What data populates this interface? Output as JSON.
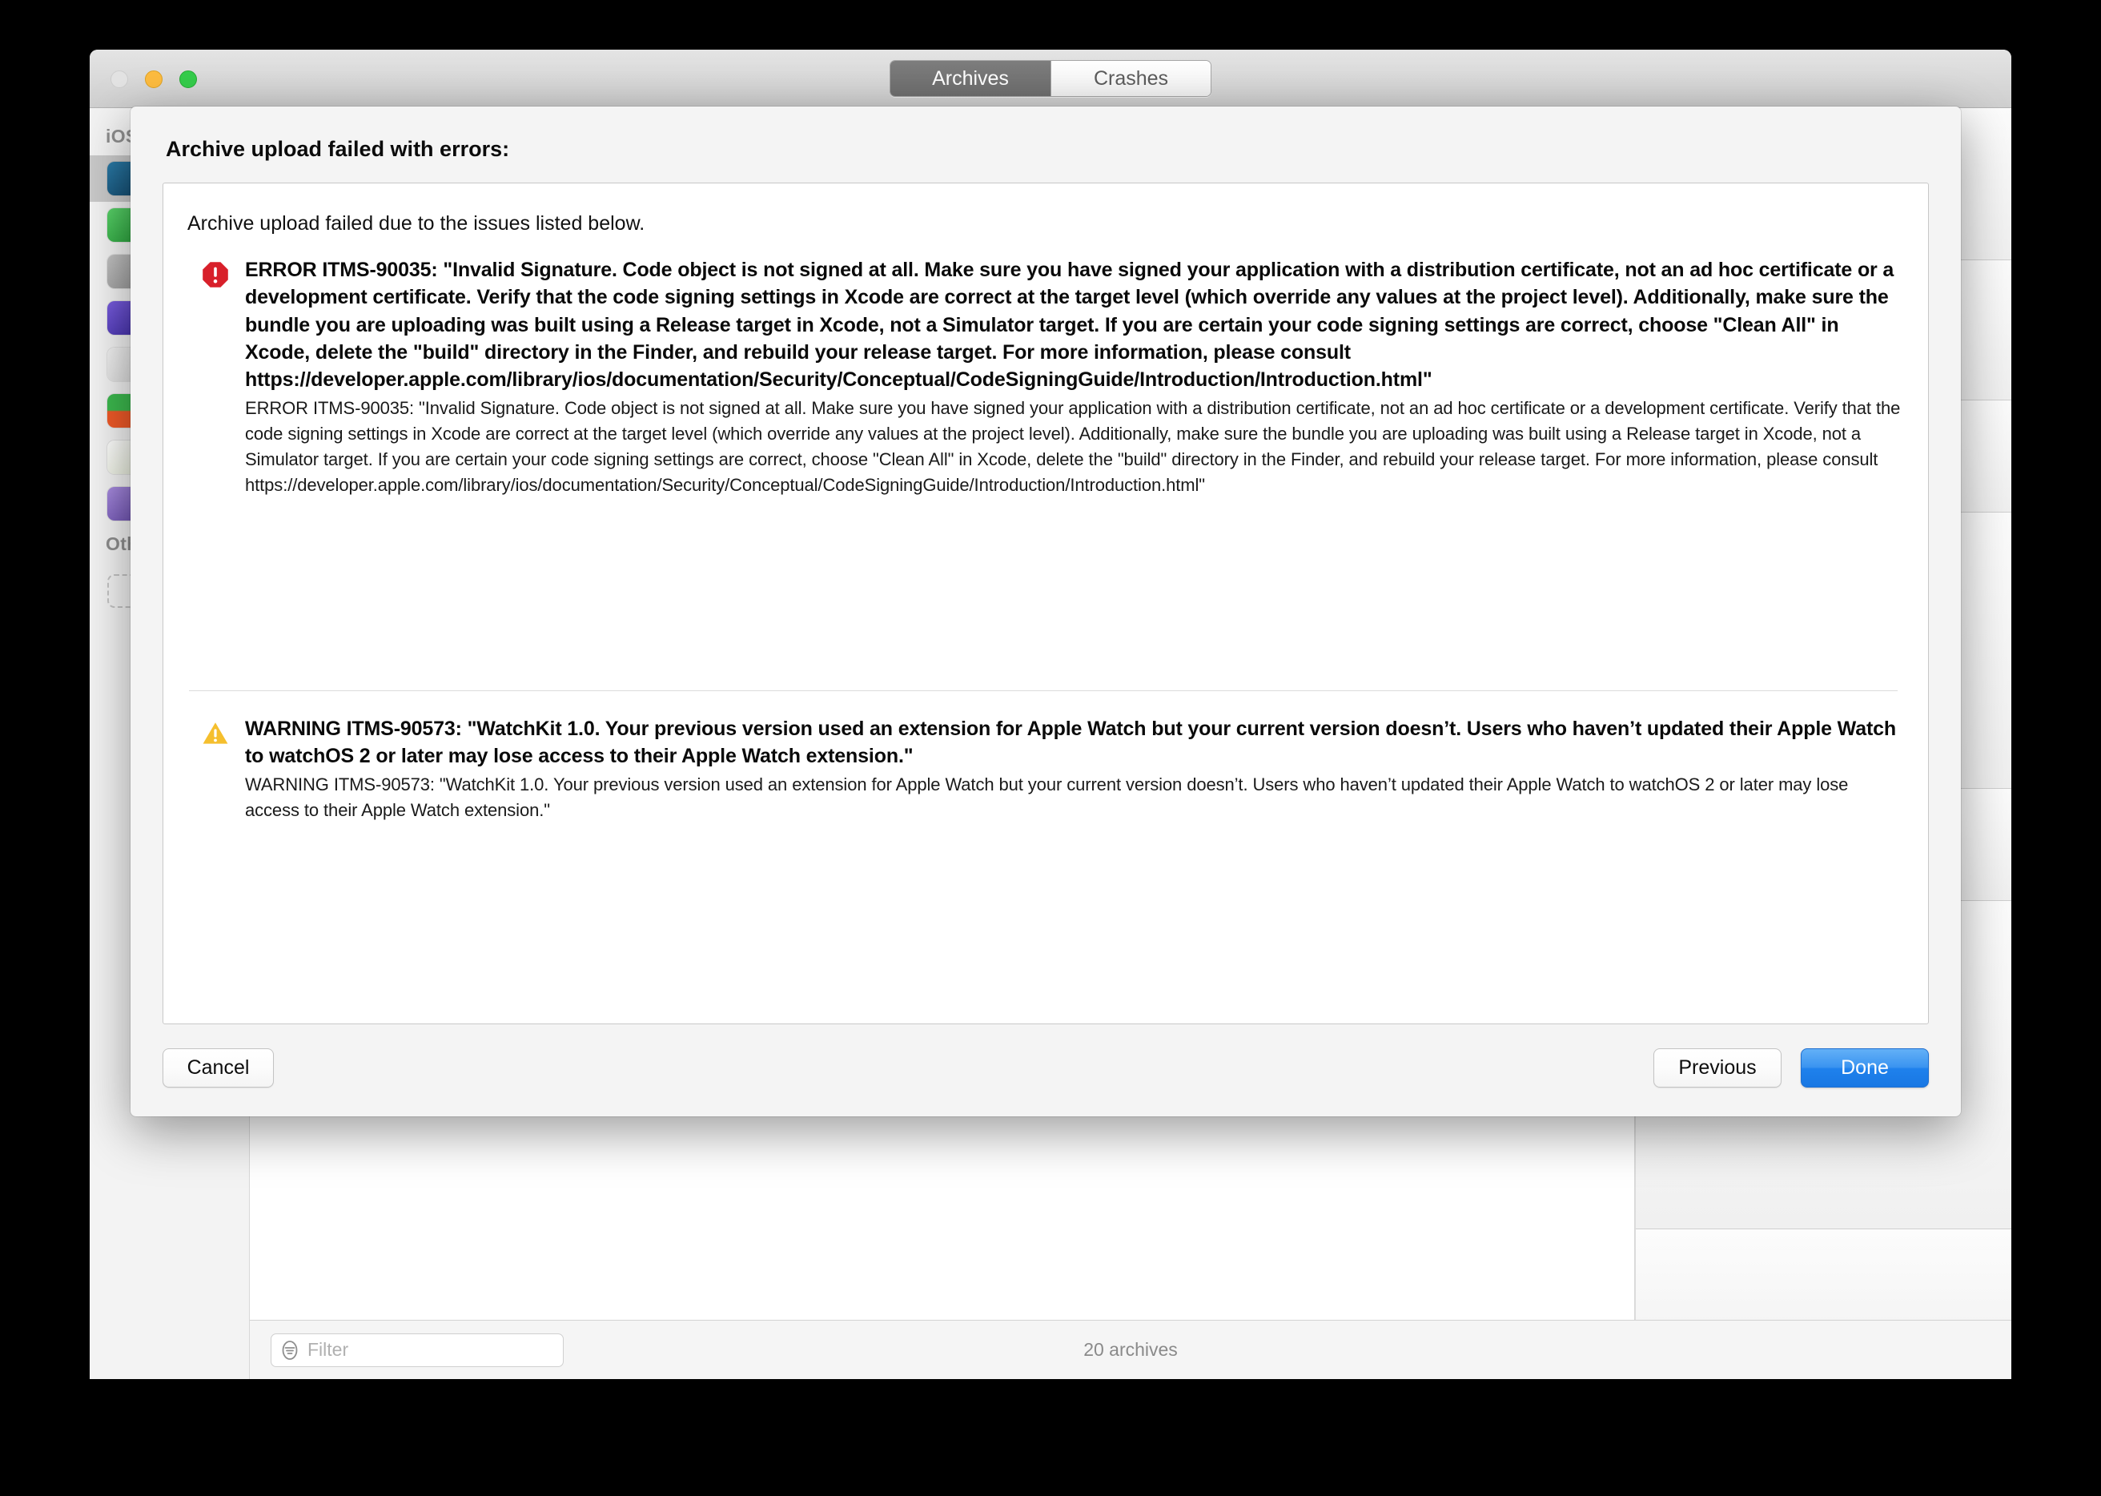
{
  "window": {
    "traffic_lights": [
      "close",
      "minimize",
      "zoom"
    ],
    "tabs": [
      {
        "label": "Archives",
        "selected": true
      },
      {
        "label": "Crashes",
        "selected": false
      }
    ],
    "sidebar": {
      "section_ios": "iOS",
      "section_other": "Other",
      "apps": [
        {
          "color": "#1d5f86",
          "selected": true
        },
        {
          "color": "#3cb94e",
          "selected": false
        },
        {
          "color": "#a9a9a9",
          "selected": false
        },
        {
          "color": "#5a42c4",
          "selected": false
        },
        {
          "color": "#e9e9e9",
          "selected": false
        },
        {
          "color": "#f05a28",
          "selected": false
        },
        {
          "color": "#f4f4ee",
          "selected": false
        },
        {
          "color": "#8a6fc4",
          "selected": false
        }
      ]
    },
    "bottom_bar": {
      "filter_placeholder": "Filter",
      "archive_count": "20 archives"
    }
  },
  "sheet": {
    "title": "Archive upload failed with errors:",
    "intro": "Archive upload failed due to the issues listed below.",
    "issues": [
      {
        "severity": "error",
        "icon": "error-octagon-icon",
        "title": "ERROR ITMS-90035: \"Invalid Signature. Code object is not signed at all. Make sure you have signed your application with a distribution certificate, not an ad hoc certificate or a development certificate. Verify that the code signing settings in Xcode are correct at the target level (which override any values at the project level). Additionally, make sure the bundle you are uploading was built using a Release target in Xcode, not a Simulator target. If you are certain your code signing settings are correct, choose \"Clean All\" in Xcode, delete the \"build\" directory in the Finder, and rebuild your release target. For more information, please consult https://developer.apple.com/library/ios/documentation/Security/Conceptual/CodeSigningGuide/Introduction/Introduction.html\"",
        "detail": "ERROR ITMS-90035: \"Invalid Signature. Code object is not signed at all. Make sure you have signed your application with a distribution certificate, not an ad hoc certificate or a development certificate. Verify that the code signing settings in Xcode are correct at the target level (which override any values at the project level). Additionally, make sure the bundle you are uploading was built using a Release target in Xcode, not a Simulator target. If you are certain your code signing settings are correct, choose \"Clean All\" in Xcode, delete the \"build\" directory in the Finder, and rebuild your release target. For more information, please consult https://developer.apple.com/library/ios/documentation/Security/Conceptual/CodeSigningGuide/Introduction/Introduction.html\""
      },
      {
        "severity": "warning",
        "icon": "warning-triangle-icon",
        "title": "WARNING ITMS-90573: \"WatchKit 1.0. Your previous version used an extension for Apple Watch but your current version doesn’t. Users who haven’t updated their Apple Watch to watchOS 2 or later may lose access to their Apple Watch extension.\"",
        "detail": "WARNING ITMS-90573: \"WatchKit 1.0. Your previous version used an extension for Apple Watch but your current version doesn’t. Users who haven’t updated their Apple Watch to watchOS 2 or later may lose access to their Apple Watch extension.\""
      }
    ],
    "buttons": {
      "cancel": "Cancel",
      "previous": "Previous",
      "done": "Done"
    }
  },
  "colors": {
    "error_red": "#d8202a",
    "warning_yellow": "#f5bf2e",
    "accent_blue": "#1f81ec",
    "tab_selected_bg": "#6e6e6e"
  }
}
